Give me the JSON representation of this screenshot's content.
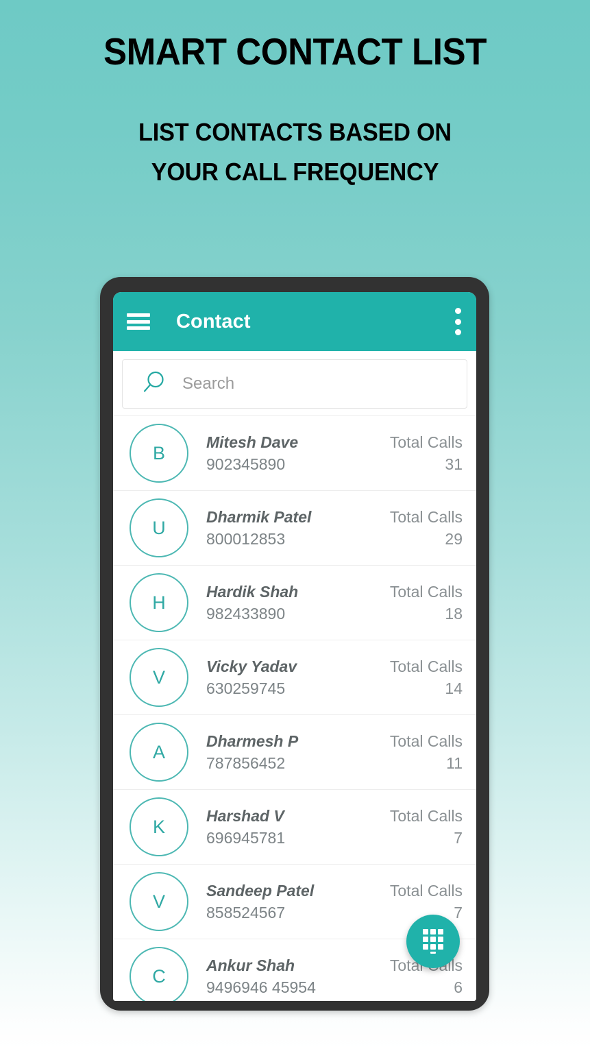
{
  "promo": {
    "title": "SMART CONTACT LIST",
    "subtitle_line1": "LIST CONTACTS BASED ON",
    "subtitle_line2": "YOUR CALL FREQUENCY"
  },
  "colors": {
    "accent": "#20b2aa",
    "avatar_outline": "#4db8b3",
    "background_top": "#6ecac5",
    "background_bottom": "#ffffff",
    "device_frame": "#323232"
  },
  "app": {
    "appbar": {
      "menu_icon": "hamburger-menu-icon",
      "title": "Contact",
      "overflow_icon": "more-vertical-icon"
    },
    "search": {
      "icon": "search-icon",
      "placeholder": "Search",
      "value": ""
    },
    "list": {
      "calls_label": "Total Calls",
      "contacts": [
        {
          "initial": "B",
          "name": "Mitesh Dave",
          "phone": "902345890",
          "calls_label": "Total Calls",
          "calls": "31"
        },
        {
          "initial": "U",
          "name": "Dharmik Patel",
          "phone": "800012853",
          "calls_label": "Total Calls",
          "calls": "29"
        },
        {
          "initial": "H",
          "name": "Hardik Shah",
          "phone": "982433890",
          "calls_label": "Total Calls",
          "calls": "18"
        },
        {
          "initial": "V",
          "name": "Vicky Yadav",
          "phone": "630259745",
          "calls_label": "Total Calls",
          "calls": "14"
        },
        {
          "initial": "A",
          "name": "Dharmesh P",
          "phone": "787856452",
          "calls_label": "Total Calls",
          "calls": "11"
        },
        {
          "initial": "K",
          "name": "Harshad V",
          "phone": "696945781",
          "calls_label": "Total Calls",
          "calls": "7"
        },
        {
          "initial": "V",
          "name": "Sandeep Patel",
          "phone": "858524567",
          "calls_label": "Total Calls",
          "calls": "7"
        },
        {
          "initial": "C",
          "name": "Ankur Shah",
          "phone": "9496946 45954",
          "calls_label": "Total Calls",
          "calls": "6"
        }
      ]
    },
    "fab": {
      "icon": "dialpad-icon",
      "label": "Dialpad"
    }
  }
}
